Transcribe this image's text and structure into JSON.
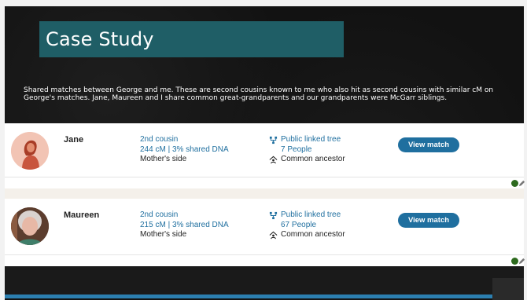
{
  "slide": {
    "title": "Case Study",
    "description": "Shared matches between George and me.  These are second cousins known to me who also hit as second cousins with similar cM on George's matches.  Jane, Maureen and I share common great-grandparents and our grandparents were McGarr siblings."
  },
  "matches": [
    {
      "name": "Jane",
      "relationship": "2nd cousin",
      "dna": "244 cM | 3% shared DNA",
      "side": "Mother's side",
      "tree_label": "Public linked tree",
      "tree_count": "7 People",
      "ancestor": "Common ancestor",
      "button": "View match"
    },
    {
      "name": "Maureen",
      "relationship": "2nd cousin",
      "dna": "215 cM | 3% shared DNA",
      "side": "Mother's side",
      "tree_label": "Public linked tree",
      "tree_count": "67 People",
      "ancestor": "Common ancestor",
      "button": "View match"
    }
  ],
  "icons": {
    "tree": "family-tree-icon",
    "ancestor": "common-ancestor-icon",
    "status": "status-dot-icon",
    "edit": "pencil-icon"
  },
  "colors": {
    "title_bg": "#1f5e66",
    "link": "#1f6f9f",
    "button": "#1f6f9f",
    "status": "#2d6a1e"
  }
}
